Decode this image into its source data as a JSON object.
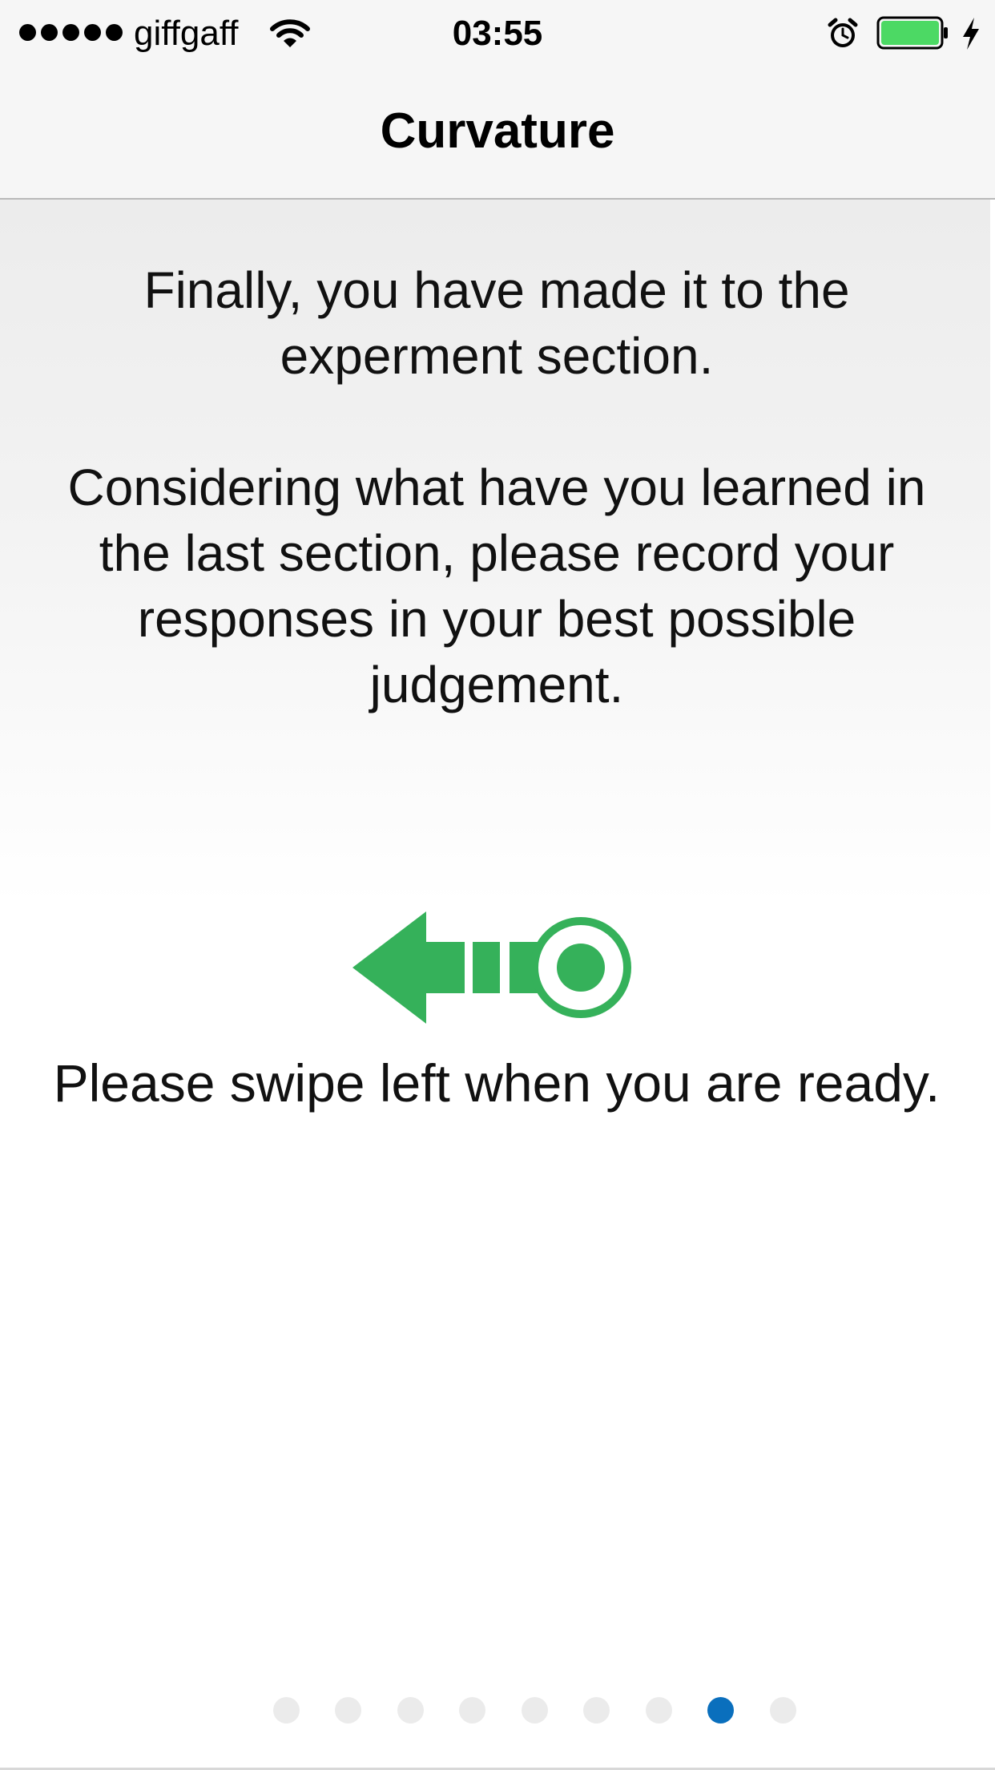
{
  "status_bar": {
    "carrier": "giffgaff",
    "time": "03:55",
    "signal_bars": 5,
    "icons": [
      "signal-dots",
      "wifi-icon",
      "alarm-icon",
      "battery-icon",
      "charging-bolt-icon"
    ],
    "battery_color": "#4cd964"
  },
  "nav": {
    "title": "Curvature"
  },
  "content": {
    "intro_text": "Finally, you have made it to the experment section.",
    "instruction_text": "Considering what have you learned in the last section, please record your responses in your best possible judgement.",
    "swipe_icon": "swipe-left-arrow-icon",
    "swipe_icon_color": "#35b15a",
    "swipe_prompt": "Please swipe left when you are ready."
  },
  "pager": {
    "page_count": 9,
    "current_page": 8,
    "active_color": "#0a6fbd",
    "inactive_color": "#ebebeb"
  }
}
